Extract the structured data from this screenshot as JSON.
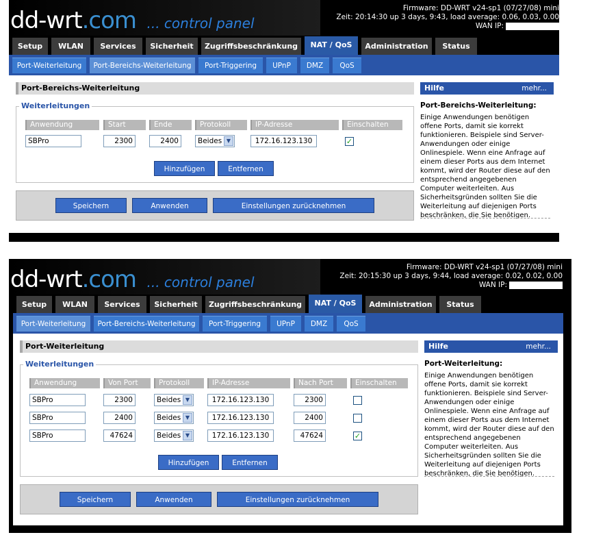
{
  "logo": {
    "dd": "dd-wrt",
    "com": ".com",
    "tagline": "... control panel"
  },
  "panel1": {
    "status": {
      "firmware": "Firmware: DD-WRT v24-sp1 (07/27/08) mini",
      "uptime": "Zeit: 20:14:30 up 3 days, 9:43, load average: 0.06, 0.03, 0.00",
      "wan_label": "WAN IP:"
    },
    "section_title": "Port-Bereichs-Weiterleitung",
    "legend": "Weiterleitungen",
    "columns": [
      "Anwendung",
      "Start",
      "Ende",
      "Protokoll",
      "IP-Adresse",
      "Einschalten"
    ],
    "rows": [
      {
        "app": "SBPro",
        "start": "2300",
        "end": "2400",
        "proto": "Beides",
        "ip": "172.16.123.130",
        "enabled": true
      }
    ],
    "add_label": "Hinzufügen",
    "remove_label": "Entfernen",
    "help_title": "Port-Bereichs-Weiterleitung:",
    "help_text": "Einige Anwendungen benötigen offene Ports, damit sie korrekt funktionieren. Beispiele sind Server-Anwendungen oder einige Onlinespiele. Wenn eine Anfrage auf einem dieser Ports aus dem Internet kommt, wird der Router diese auf den entsprechend angegebenen Computer weiterleiten. Aus Sicherheitsgründen sollten Sie die Weiterleitung auf diejenigen Ports beschränken, die Sie benötigen."
  },
  "panel2": {
    "status": {
      "firmware": "Firmware: DD-WRT v24-sp1 (07/27/08) mini",
      "uptime": "Zeit: 20:15:30 up 3 days, 9:44, load average: 0.02, 0.02, 0.00",
      "wan_label": "WAN IP:"
    },
    "section_title": "Port-Weiterleitung",
    "legend": "Weiterleitungen",
    "columns": [
      "Anwendung",
      "Von Port",
      "Protokoll",
      "IP-Adresse",
      "Nach Port",
      "Einschalten"
    ],
    "rows": [
      {
        "app": "SBPro",
        "from": "2300",
        "proto": "Beides",
        "ip": "172.16.123.130",
        "to": "2300",
        "enabled": false
      },
      {
        "app": "SBPro",
        "from": "2400",
        "proto": "Beides",
        "ip": "172.16.123.130",
        "to": "2400",
        "enabled": false
      },
      {
        "app": "SBPro",
        "from": "47624",
        "proto": "Beides",
        "ip": "172.16.123.130",
        "to": "47624",
        "enabled": true
      }
    ],
    "add_label": "Hinzufügen",
    "remove_label": "Entfernen",
    "help_title": "Port-Weiterleitung:",
    "help_text": "Einige Anwendungen benötigen offene Ports, damit sie korrekt funktionieren. Beispiele sind Server-Anwendungen oder einige Onlinespiele. Wenn eine Anfrage auf einem dieser Ports aus dem Internet kommt, wird der Router diese auf den entsprechend angegebenen Computer weiterleiten. Aus Sicherheitsgründen sollten Sie die Weiterleitung auf diejenigen Ports beschränken, die Sie benötigen."
  },
  "tabs": [
    "Setup",
    "WLAN",
    "Services",
    "Sicherheit",
    "Zugriffsbeschränkung",
    "NAT / QoS",
    "Administration",
    "Status"
  ],
  "active_tab": "NAT / QoS",
  "subtabs": [
    "Port-Weiterleitung",
    "Port-Bereichs-Weiterleitung",
    "Port-Triggering",
    "UPnP",
    "DMZ",
    "QoS"
  ],
  "buttons": {
    "save": "Speichern",
    "apply": "Anwenden",
    "reset": "Einstellungen zurücknehmen"
  },
  "help": {
    "title": "Hilfe",
    "more": "mehr..."
  },
  "colors": {
    "accent_blue": "#2a55a8",
    "tab_dark": "#3c3c3c",
    "button_blue": "#3a6cc6",
    "check_green": "#21a121"
  }
}
